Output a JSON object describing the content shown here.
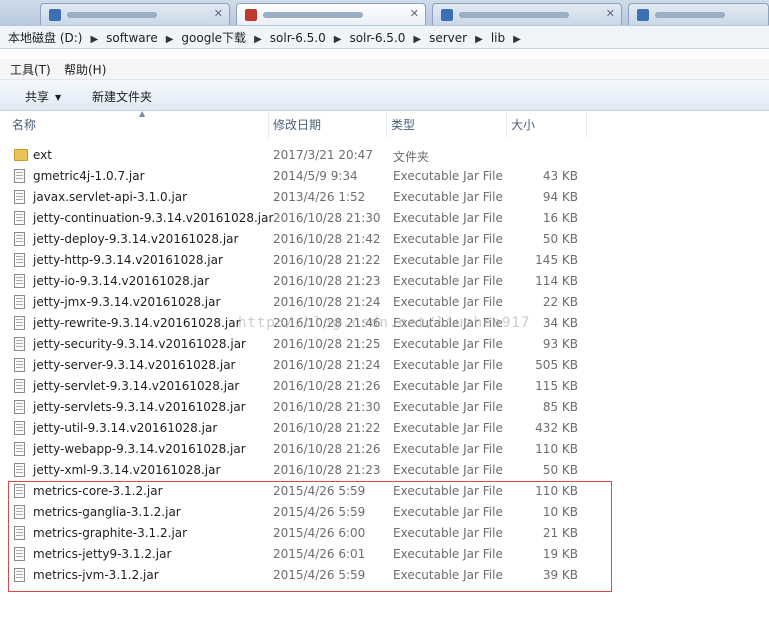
{
  "path": [
    "本地磁盘 (D:)",
    "software",
    "google下载",
    "solr-6.5.0",
    "solr-6.5.0",
    "server",
    "lib"
  ],
  "menu": [
    "工具(T)",
    "帮助(H)"
  ],
  "toolbar": {
    "share": "共享",
    "new_folder": "新建文件夹"
  },
  "columns": {
    "name": "名称",
    "date": "修改日期",
    "type": "类型",
    "size": "大小"
  },
  "files": [
    {
      "name": "ext",
      "date": "2017/3/21 20:47",
      "type": "文件夹",
      "size": "",
      "icon": "folder-icon"
    },
    {
      "name": "gmetric4j-1.0.7.jar",
      "date": "2014/5/9 9:34",
      "type": "Executable Jar File",
      "size": "43 KB",
      "icon": "jar-file-icon"
    },
    {
      "name": "javax.servlet-api-3.1.0.jar",
      "date": "2013/4/26 1:52",
      "type": "Executable Jar File",
      "size": "94 KB",
      "icon": "jar-file-icon"
    },
    {
      "name": "jetty-continuation-9.3.14.v20161028.jar",
      "date": "2016/10/28 21:30",
      "type": "Executable Jar File",
      "size": "16 KB",
      "icon": "jar-file-icon"
    },
    {
      "name": "jetty-deploy-9.3.14.v20161028.jar",
      "date": "2016/10/28 21:42",
      "type": "Executable Jar File",
      "size": "50 KB",
      "icon": "jar-file-icon"
    },
    {
      "name": "jetty-http-9.3.14.v20161028.jar",
      "date": "2016/10/28 21:22",
      "type": "Executable Jar File",
      "size": "145 KB",
      "icon": "jar-file-icon"
    },
    {
      "name": "jetty-io-9.3.14.v20161028.jar",
      "date": "2016/10/28 21:23",
      "type": "Executable Jar File",
      "size": "114 KB",
      "icon": "jar-file-icon"
    },
    {
      "name": "jetty-jmx-9.3.14.v20161028.jar",
      "date": "2016/10/28 21:24",
      "type": "Executable Jar File",
      "size": "22 KB",
      "icon": "jar-file-icon"
    },
    {
      "name": "jetty-rewrite-9.3.14.v20161028.jar",
      "date": "2016/10/28 21:46",
      "type": "Executable Jar File",
      "size": "34 KB",
      "icon": "jar-file-icon"
    },
    {
      "name": "jetty-security-9.3.14.v20161028.jar",
      "date": "2016/10/28 21:25",
      "type": "Executable Jar File",
      "size": "93 KB",
      "icon": "jar-file-icon"
    },
    {
      "name": "jetty-server-9.3.14.v20161028.jar",
      "date": "2016/10/28 21:24",
      "type": "Executable Jar File",
      "size": "505 KB",
      "icon": "jar-file-icon"
    },
    {
      "name": "jetty-servlet-9.3.14.v20161028.jar",
      "date": "2016/10/28 21:26",
      "type": "Executable Jar File",
      "size": "115 KB",
      "icon": "jar-file-icon"
    },
    {
      "name": "jetty-servlets-9.3.14.v20161028.jar",
      "date": "2016/10/28 21:30",
      "type": "Executable Jar File",
      "size": "85 KB",
      "icon": "jar-file-icon"
    },
    {
      "name": "jetty-util-9.3.14.v20161028.jar",
      "date": "2016/10/28 21:22",
      "type": "Executable Jar File",
      "size": "432 KB",
      "icon": "jar-file-icon"
    },
    {
      "name": "jetty-webapp-9.3.14.v20161028.jar",
      "date": "2016/10/28 21:26",
      "type": "Executable Jar File",
      "size": "110 KB",
      "icon": "jar-file-icon"
    },
    {
      "name": "jetty-xml-9.3.14.v20161028.jar",
      "date": "2016/10/28 21:23",
      "type": "Executable Jar File",
      "size": "50 KB",
      "icon": "jar-file-icon"
    },
    {
      "name": "metrics-core-3.1.2.jar",
      "date": "2015/4/26 5:59",
      "type": "Executable Jar File",
      "size": "110 KB",
      "icon": "jar-file-icon"
    },
    {
      "name": "metrics-ganglia-3.1.2.jar",
      "date": "2015/4/26 5:59",
      "type": "Executable Jar File",
      "size": "10 KB",
      "icon": "jar-file-icon"
    },
    {
      "name": "metrics-graphite-3.1.2.jar",
      "date": "2015/4/26 6:00",
      "type": "Executable Jar File",
      "size": "21 KB",
      "icon": "jar-file-icon"
    },
    {
      "name": "metrics-jetty9-3.1.2.jar",
      "date": "2015/4/26 6:01",
      "type": "Executable Jar File",
      "size": "19 KB",
      "icon": "jar-file-icon"
    },
    {
      "name": "metrics-jvm-3.1.2.jar",
      "date": "2015/4/26 5:59",
      "type": "Executable Jar File",
      "size": "39 KB",
      "icon": "jar-file-icon"
    }
  ],
  "watermark": "http://blog.csdn.net/liuzhen917",
  "colors": {
    "highlight_border": "#e04747",
    "column_header_text": "#4c607a"
  }
}
